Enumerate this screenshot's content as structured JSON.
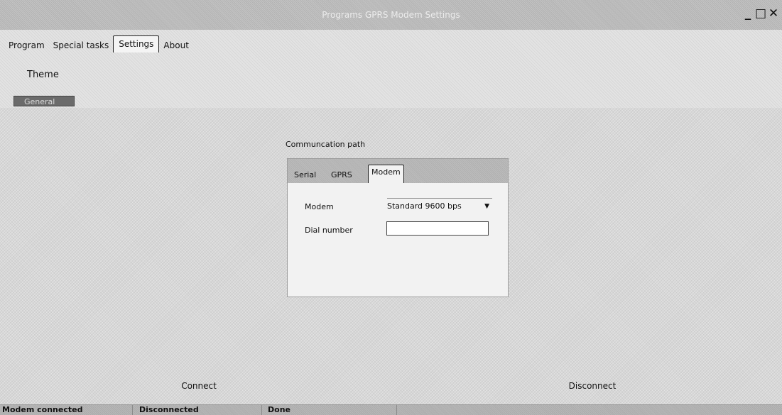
{
  "window": {
    "title": "Programs GPRS Modem Settings",
    "controls": [
      "_",
      "□",
      "✕"
    ]
  },
  "main_tabs": [
    {
      "label": "Program",
      "active": false
    },
    {
      "label": "Special tasks",
      "active": false
    },
    {
      "label": "Settings",
      "active": true
    },
    {
      "label": "About",
      "active": false
    }
  ],
  "ribbon": {
    "theme_label": "Theme",
    "group_label": "General"
  },
  "comm": {
    "label": "Communcation path",
    "tabs": [
      {
        "label": "Serial",
        "active": false
      },
      {
        "label": "GPRS",
        "active": false
      },
      {
        "label": "Modem",
        "active": true
      }
    ],
    "modem_label": "Modem",
    "modem_value": "Standard  9600 bps",
    "dial_label": "Dial number",
    "dial_value": ""
  },
  "actions": {
    "connect": "Connect",
    "disconnect": "Disconnect"
  },
  "status": {
    "left": "Modem connected",
    "middle": "Disconnected",
    "right": "Done"
  }
}
